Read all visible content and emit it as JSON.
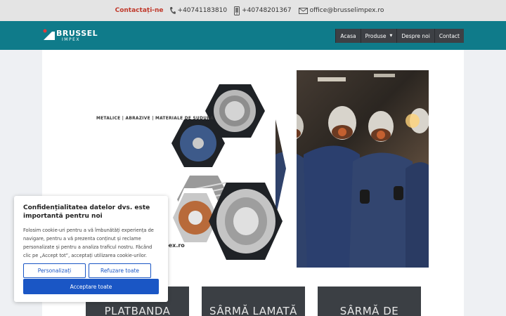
{
  "topbar": {
    "contact_label": "Contactați-ne",
    "phone1": "+40741183810",
    "phone2": "+40748201367",
    "email": "office@brusselimpex.ro"
  },
  "header": {
    "brand": "BRUSSEL",
    "brand_sub": "IMPEX",
    "menu": {
      "home": "Acasa",
      "products": "Produse",
      "about": "Despre noi",
      "contact": "Contact"
    }
  },
  "hero": {
    "tagline": "METALICE | ABRAZIVE | MATERIALE DE SUDURA",
    "domain_partial": "pex.ro"
  },
  "cards": [
    {
      "title": "PLATBANDA"
    },
    {
      "title": "SÂRMĂ LAMATĂ"
    },
    {
      "title": "SÂRMĂ DE"
    }
  ],
  "cookie": {
    "title": "Confidențialitatea datelor dvs. este importantă pentru noi",
    "text": "Folosim cookie-uri pentru a vă îmbunătăți experiența de navigare, pentru a vă prezenta conținut și reclame personalizate și pentru a analiza traficul nostru. Făcând clic pe „Accept tot”, acceptați utilizarea cookie-urilor.",
    "customize_label": "Personalizați",
    "reject_label": "Refuzare toate",
    "accept_label": "Acceptare toate"
  },
  "colors": {
    "nav_bg": "#0f7b8a",
    "menu_bg": "#3d4045",
    "accent_red": "#c0392b",
    "button_blue": "#1a56c5"
  }
}
